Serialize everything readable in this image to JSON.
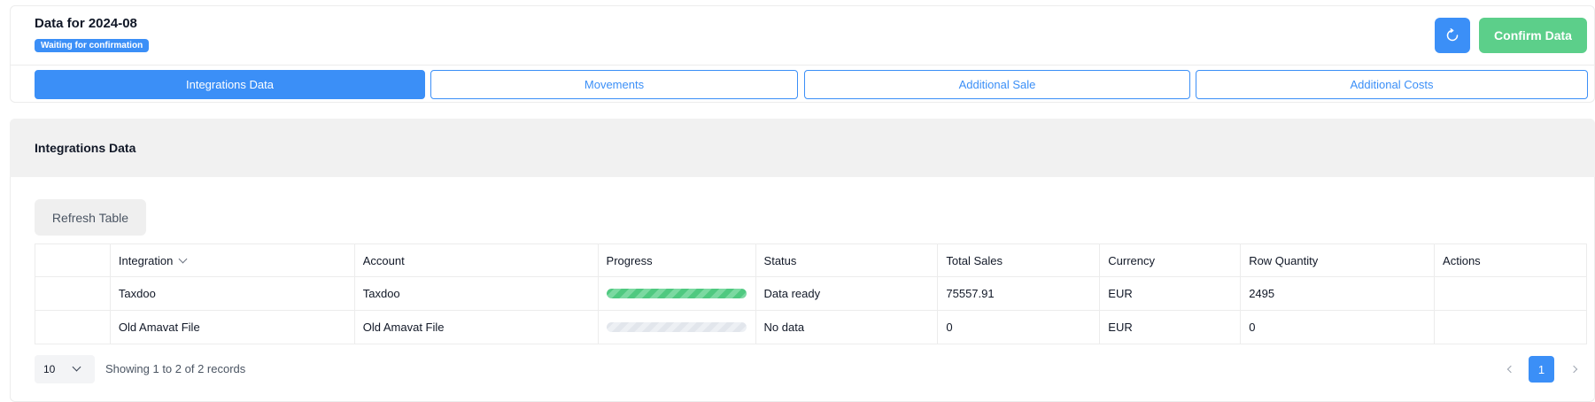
{
  "header": {
    "title": "Data for 2024-08",
    "status_badge": "Waiting for confirmation",
    "refresh_icon": "refresh-icon",
    "confirm_label": "Confirm Data",
    "colors": {
      "accent": "#3b8ff7",
      "confirm": "#5ccf8a"
    }
  },
  "tabs": [
    {
      "label": "Integrations Data",
      "active": true
    },
    {
      "label": "Movements",
      "active": false
    },
    {
      "label": "Additional Sale",
      "active": false
    },
    {
      "label": "Additional Costs",
      "active": false
    }
  ],
  "section": {
    "title": "Integrations Data",
    "refresh_table_label": "Refresh Table"
  },
  "table": {
    "columns": [
      "",
      "Integration",
      "Account",
      "Progress",
      "Status",
      "Total Sales",
      "Currency",
      "Row Quantity",
      "Actions"
    ],
    "rows": [
      {
        "integration": "Taxdoo",
        "account": "Taxdoo",
        "progress": 1.0,
        "status": "Data ready",
        "total_sales": "75557.91",
        "currency": "EUR",
        "row_quantity": "2495",
        "actions": ""
      },
      {
        "integration": "Old Amavat File",
        "account": "Old Amavat File",
        "progress": 0.0,
        "status": "No data",
        "total_sales": "0",
        "currency": "EUR",
        "row_quantity": "0",
        "actions": ""
      }
    ]
  },
  "pagination": {
    "page_size": "10",
    "showing": "Showing 1 to 2 of 2 records",
    "current_page": "1"
  }
}
